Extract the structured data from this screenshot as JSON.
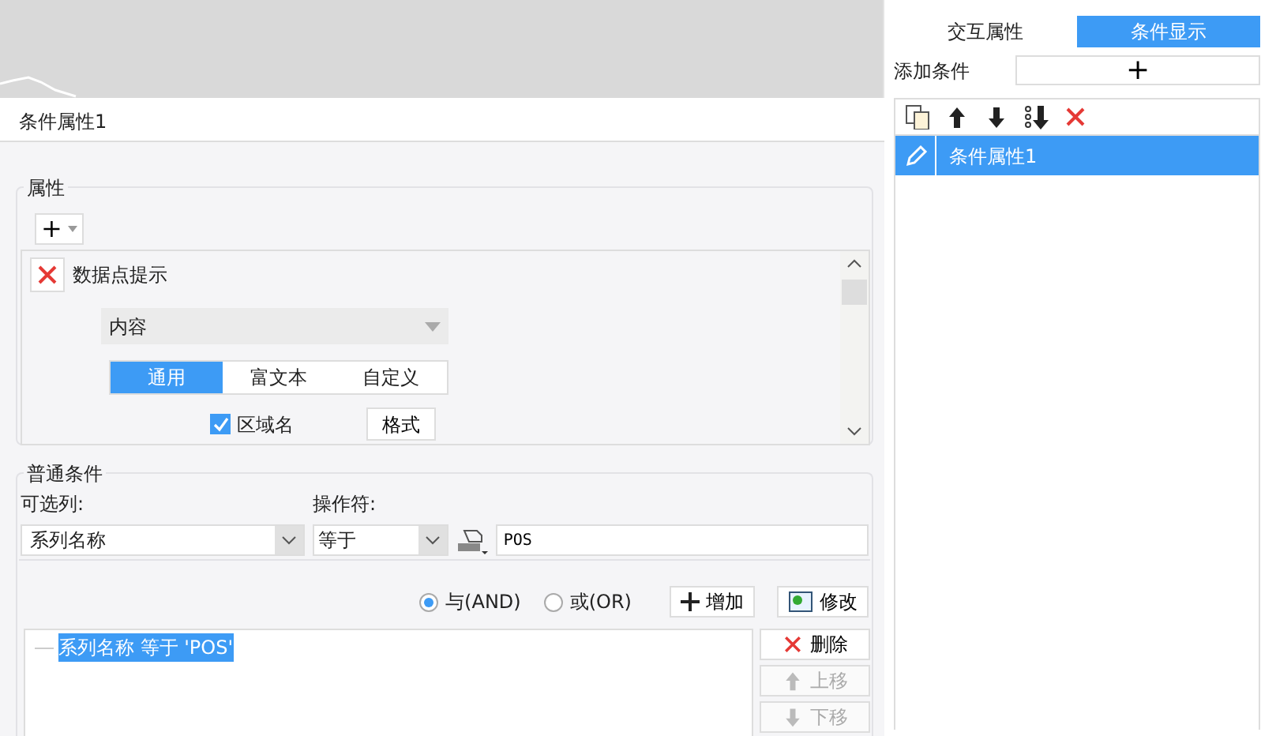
{
  "dialog": {
    "title": "条件属性1"
  },
  "right_panel": {
    "tabs": [
      {
        "label": "交互属性",
        "selected": false
      },
      {
        "label": "条件显示",
        "selected": true
      }
    ],
    "add_label": "添加条件",
    "add_button": "+",
    "toolbar": [
      {
        "kind": "copy"
      },
      {
        "kind": "up"
      },
      {
        "kind": "down"
      },
      {
        "kind": "bottom"
      },
      {
        "kind": "delete"
      }
    ],
    "conditions": [
      {
        "label": "条件属性1",
        "selected": true
      }
    ]
  },
  "properties": {
    "legend": "属性",
    "add_button": "+",
    "items": [
      {
        "label": "数据点提示",
        "content_select": "内容",
        "tabs": [
          {
            "label": "通用",
            "selected": true
          },
          {
            "label": "富文本",
            "selected": false
          },
          {
            "label": "自定义",
            "selected": false
          }
        ],
        "checkbox": {
          "label": "区域名",
          "checked": true
        },
        "format_button": "格式"
      }
    ]
  },
  "conditions": {
    "legend": "普通条件",
    "column_label": "可选列:",
    "column_value": "系列名称",
    "operator_label": "操作符:",
    "operator_value": "等于",
    "value": "POS",
    "logic": [
      {
        "label": "与(AND)",
        "selected": true
      },
      {
        "label": "或(OR)",
        "selected": false
      }
    ],
    "add_button": "增加",
    "edit_button": "修改",
    "list": [
      {
        "text": "系列名称 等于 'POS'",
        "selected": true
      }
    ],
    "side_buttons": [
      {
        "kind": "delete",
        "label": "删除",
        "disabled": false
      },
      {
        "kind": "up",
        "label": "上移",
        "disabled": true
      },
      {
        "kind": "down",
        "label": "下移",
        "disabled": true
      }
    ]
  }
}
